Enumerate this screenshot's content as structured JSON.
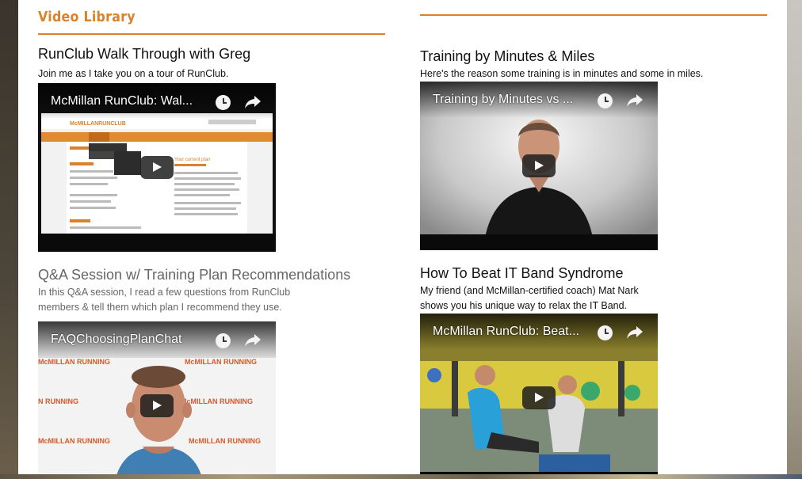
{
  "library": {
    "title": "Video Library"
  },
  "left": [
    {
      "title": "RunClub Walk Through with Greg",
      "desc_lines": [
        "Join me as I take you on a tour of RunClub."
      ],
      "player_title": "McMillan RunClub: Wal...",
      "muted": false
    },
    {
      "title": "Q&A Session w/ Training Plan Recommendations",
      "desc_lines": [
        "In this Q&A session, I read a few questions from RunClub",
        "members & tell them which plan I recommend they use."
      ],
      "player_title": "FAQChoosingPlanChat",
      "muted": true
    }
  ],
  "right": [
    {
      "title": "Training by Minutes & Miles",
      "desc_lines": [
        "Here's the reason some training is in minutes and some in miles."
      ],
      "player_title": "Training by Minutes vs ...",
      "muted": false
    },
    {
      "title": "How To Beat IT Band Syndrome",
      "desc_lines": [
        "My friend (and McMillan-certified coach) Mat Nark",
        "shows you his unique way to relax the IT Band."
      ],
      "player_title": "McMillan RunClub: Beat...",
      "muted": false
    }
  ],
  "thumbnail_text": {
    "site_logo": "McMILLANRUNCLUB",
    "plan_heading": "Your current plan",
    "backdrop_brand": "McMILLAN RUNNING"
  },
  "icons": {
    "watch_later": "clock-icon",
    "share": "share-arrow-icon",
    "play": "play-icon"
  },
  "colors": {
    "accent": "#d9822b",
    "text": "#111111",
    "muted_text": "#666666"
  }
}
